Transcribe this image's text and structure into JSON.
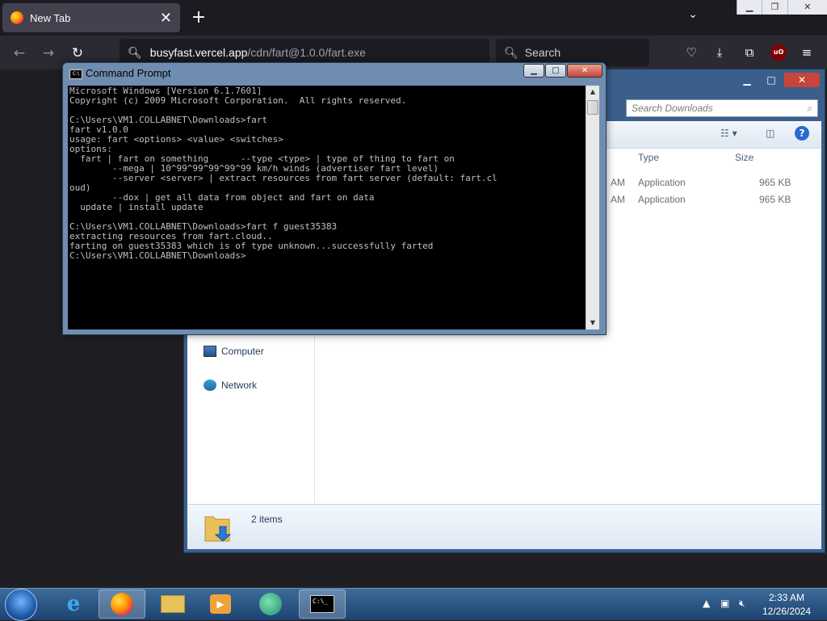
{
  "browser": {
    "tab_title": "New Tab",
    "url_host": "busyfast.vercel.app",
    "url_path": "/cdn/fart@1.0.0/fart.exe",
    "search_placeholder": "Search",
    "ublock_label": "uO"
  },
  "explorer": {
    "search_placeholder": "Search Downloads",
    "columns": {
      "type": "Type",
      "size": "Size"
    },
    "rows": [
      {
        "time_fragment": "AM",
        "type": "Application",
        "size": "965 KB"
      },
      {
        "time_fragment": "AM",
        "type": "Application",
        "size": "965 KB"
      }
    ],
    "nav": {
      "computer": "Computer",
      "network": "Network"
    },
    "item_count": "2 items"
  },
  "cmd": {
    "title": "Command Prompt",
    "icon_text": "C:\\",
    "output": "Microsoft Windows [Version 6.1.7601]\nCopyright (c) 2009 Microsoft Corporation.  All rights reserved.\n\nC:\\Users\\VM1.COLLABNET\\Downloads>fart\nfart v1.0.0\nusage: fart <options> <value> <switches>\noptions:\n  fart | fart on something      --type <type> | type of thing to fart on\n        --mega | 10^99^99^99^99^99 km/h winds (advertiser fart level)\n        --server <server> | extract resources from fart server (default: fart.cl\noud)\n        --dox | get all data from object and fart on data\n  update | install update\n\nC:\\Users\\VM1.COLLABNET\\Downloads>fart f guest35383\nextracting resources from fart.cloud..\nfarting on guest35383 which is of type unknown...successfully farted\nC:\\Users\\VM1.COLLABNET\\Downloads>"
  },
  "taskbar": {
    "time": "2:33 AM",
    "date": "12/26/2024",
    "cmd_icon_text": "C:\\_"
  },
  "colors": {
    "firefox_dark": "#1c1b22",
    "taskbar_blue": "#1d4270",
    "console_bg": "#000000",
    "console_text": "#c0c0c0"
  }
}
